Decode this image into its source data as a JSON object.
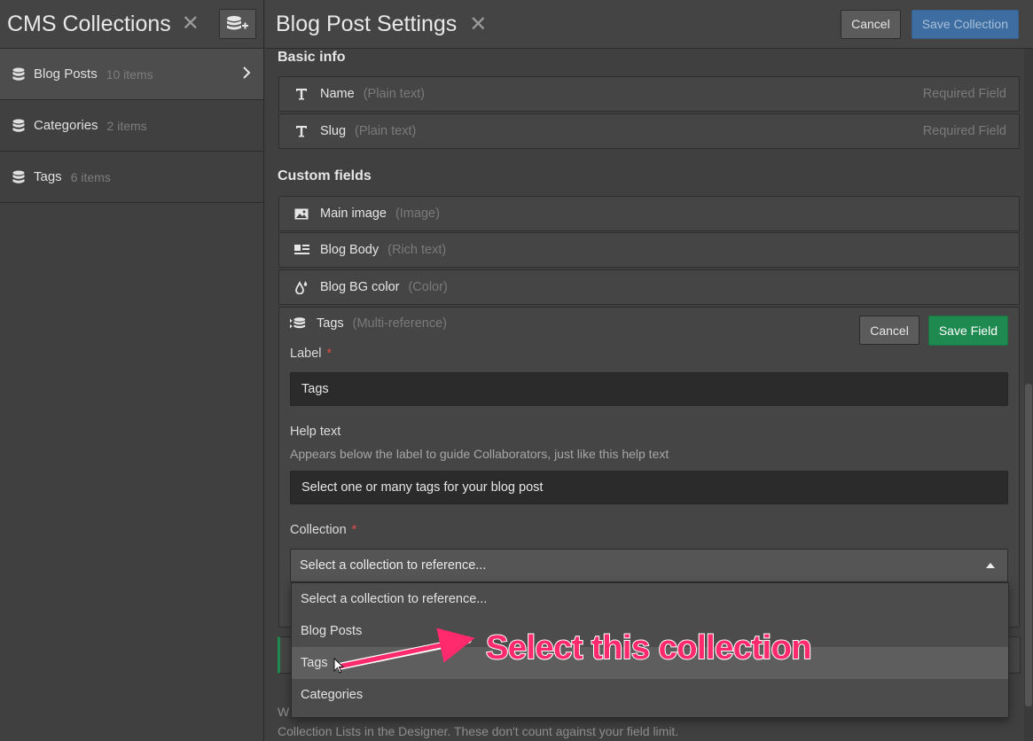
{
  "left_panel": {
    "title": "CMS Collections",
    "close_glyph": "✕",
    "add_button_icon": "database-plus-icon",
    "collections": [
      {
        "name": "Blog Posts",
        "count": "10 items",
        "active": true
      },
      {
        "name": "Categories",
        "count": "2 items",
        "active": false
      },
      {
        "name": "Tags",
        "count": "6 items",
        "active": false
      }
    ]
  },
  "header": {
    "title": "Blog Post Settings",
    "close_glyph": "✕",
    "cancel_label": "Cancel",
    "save_label": "Save Collection"
  },
  "basic_info": {
    "title": "Basic info",
    "fields": [
      {
        "icon": "text-icon",
        "name": "Name",
        "type": "(Plain text)",
        "required": "Required Field"
      },
      {
        "icon": "text-icon",
        "name": "Slug",
        "type": "(Plain text)",
        "required": "Required Field"
      }
    ]
  },
  "custom_fields": {
    "title": "Custom fields",
    "fields": [
      {
        "icon": "image-icon",
        "name": "Main image",
        "type": "(Image)"
      },
      {
        "icon": "rich-text-icon",
        "name": "Blog Body",
        "type": "(Rich text)"
      },
      {
        "icon": "color-drop-icon",
        "name": "Blog BG color",
        "type": "(Color)"
      }
    ]
  },
  "edit_field": {
    "icon": "multi-reference-icon",
    "name": "Tags",
    "type": "(Multi-reference)",
    "cancel_label": "Cancel",
    "save_label": "Save Field",
    "label_label": "Label",
    "required_mark": "*",
    "label_value": "Tags",
    "help_label": "Help text",
    "help_description": "Appears below the label to guide Collaborators, just like this help text",
    "help_value": "Select one or many tags for your blog post",
    "collection_label": "Collection",
    "collection_selected": "Select a collection to reference..."
  },
  "dropdown": {
    "options": [
      "Select a collection to reference...",
      "Blog Posts",
      "Tags",
      "Categories"
    ],
    "hovered_index": 2
  },
  "footer": {
    "line1": "W",
    "line2": "Collection Lists in the Designer. These don't count against your field limit."
  },
  "annotation": {
    "text": "Select this collection",
    "color": "#ff2a6d"
  },
  "colors": {
    "save_blue": "#3d6da1",
    "save_green": "#1e8a4f",
    "required_red": "#e04a4a"
  }
}
